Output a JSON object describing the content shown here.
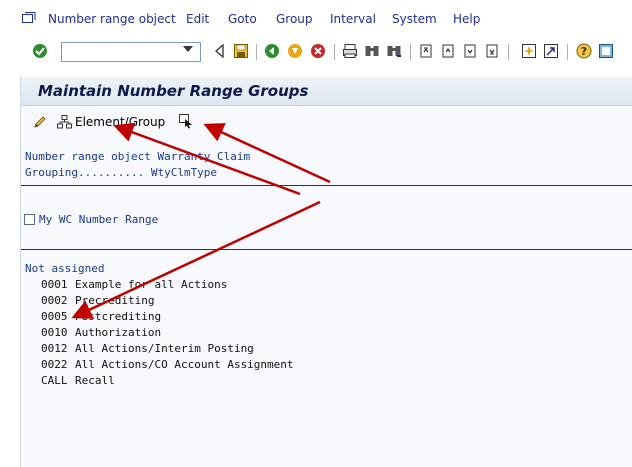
{
  "menu": {
    "items": [
      "Number range object",
      "Edit",
      "Goto",
      "Group",
      "Interval",
      "System",
      "Help"
    ]
  },
  "toolbar": {
    "command_value": "",
    "icons": [
      "enter-icon",
      "command-dropdown",
      "back-triangle-icon",
      "save-icon",
      "back-icon",
      "exit-icon",
      "cancel-icon",
      "print-icon",
      "find-icon",
      "find-next-icon",
      "first-page-icon",
      "prev-page-icon",
      "next-page-icon",
      "last-page-icon",
      "create-session-icon",
      "shortcut-icon",
      "help-icon",
      "layout-icon"
    ]
  },
  "screen": {
    "title": "Maintain Number Range Groups",
    "element_group_label": "Element/Group"
  },
  "header": {
    "object_line": "Number range object Warranty Claim",
    "grouping_line": "Grouping.......... WtyClmType"
  },
  "group": {
    "checkbox_checked": false,
    "label": "My WC Number Range"
  },
  "not_assigned": {
    "heading": "Not assigned",
    "rows": [
      {
        "code": "0001",
        "text": "Example for all Actions"
      },
      {
        "code": "0002",
        "text": "Precrediting"
      },
      {
        "code": "0005",
        "text": "Postcrediting"
      },
      {
        "code": "0010",
        "text": "Authorization"
      },
      {
        "code": "0012",
        "text": "All Actions/Interim Posting"
      },
      {
        "code": "0022",
        "text": "All Actions/CO Account Assignment"
      },
      {
        "code": "CALL",
        "text": "Recall"
      }
    ]
  },
  "colors": {
    "menu_text": "#1f2d8f",
    "list_blue": "#1a3a8f",
    "annotation_arrow": "#c00000"
  }
}
